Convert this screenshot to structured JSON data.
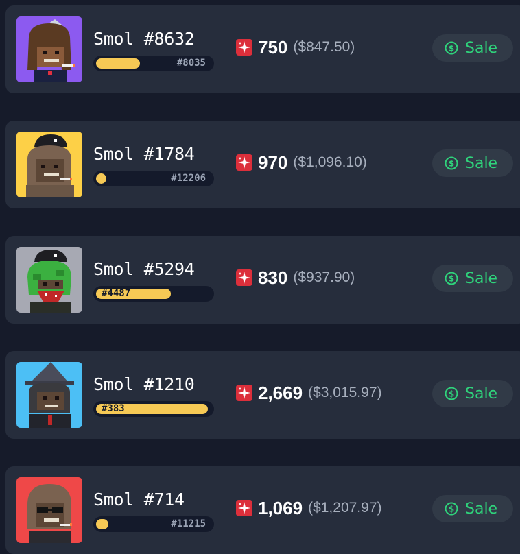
{
  "colors": {
    "page_bg": "#161b2a",
    "card_bg": "#262d3c",
    "rank_bar_bg": "#141a2b",
    "rank_fill": "#f6c955",
    "magic_icon": "#dc2f3b",
    "sale_green": "#2fd37b",
    "sale_button_bg": "#313a47"
  },
  "currency_icon": "magic-sparkle-icon",
  "sale_icon": "dollar-circle-icon",
  "listings": [
    {
      "name": "Smol #8632",
      "rank_label": "#8035",
      "rank_fill_fraction": 0.38,
      "price": "750",
      "usd": "($847.50)",
      "sale_label": "Sale",
      "avatar_bg": "#8c5af0"
    },
    {
      "name": "Smol #1784",
      "rank_label": "#12206",
      "rank_fill_fraction": 0.07,
      "price": "970",
      "usd": "($1,096.10)",
      "sale_label": "Sale",
      "avatar_bg": "#fdd047"
    },
    {
      "name": "Smol #5294",
      "rank_label": "#4487",
      "rank_fill_fraction": 0.65,
      "price": "830",
      "usd": "($937.90)",
      "sale_label": "Sale",
      "avatar_bg": "#a7a9b3"
    },
    {
      "name": "Smol #1210",
      "rank_label": "#383",
      "rank_fill_fraction": 0.97,
      "price": "2,669",
      "usd": "($3,015.97)",
      "sale_label": "Sale",
      "avatar_bg": "#4cbff5"
    },
    {
      "name": "Smol #714",
      "rank_label": "#11215",
      "rank_fill_fraction": 0.11,
      "price": "1,069",
      "usd": "($1,207.97)",
      "sale_label": "Sale",
      "avatar_bg": "#ef4848"
    }
  ]
}
